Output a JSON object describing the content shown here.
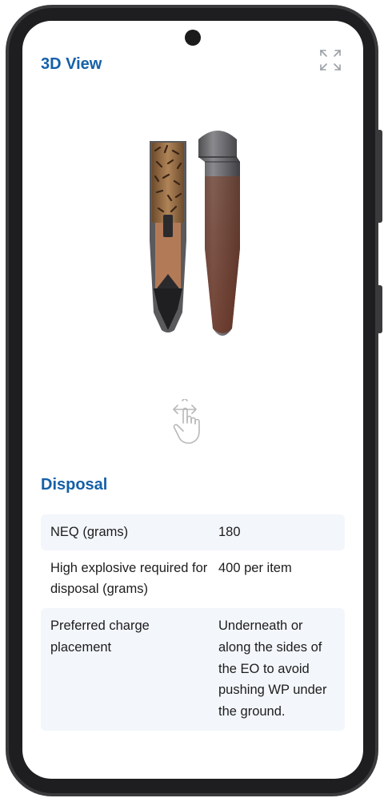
{
  "view": {
    "title": "3D View",
    "expand_icon": "expand-arrows-icon",
    "gesture_icon": "rotate-gesture-hand-icon"
  },
  "disposal": {
    "title": "Disposal",
    "rows": [
      {
        "label": "NEQ (grams)",
        "value": "180"
      },
      {
        "label": "High explosive required for disposal (grams)",
        "value": "400 per item"
      },
      {
        "label": "Preferred charge placement",
        "value": "Underneath or along the sides of the EO to avoid pushing WP under the ground."
      }
    ]
  },
  "colors": {
    "heading": "#1560a8",
    "row_shade": "#f3f6fb",
    "frame": "#3a3a3c"
  }
}
